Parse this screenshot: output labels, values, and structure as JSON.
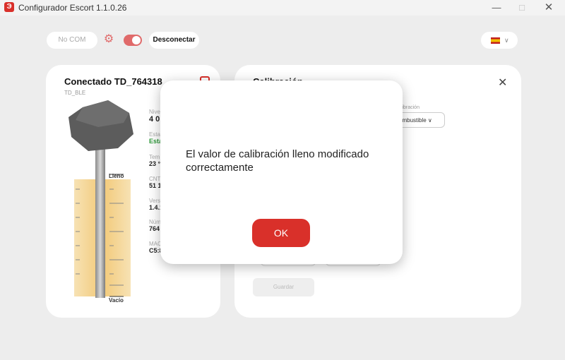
{
  "window": {
    "title": "Configurador Escort 1.1.0.26",
    "icon_letter": "Э"
  },
  "toolbar": {
    "com_label": "No COM",
    "disconnect_label": "Desconectar",
    "language_flag": "es-flag-icon"
  },
  "device": {
    "title": "Conectado  TD_764318",
    "subtitle": "TD_BLE",
    "level_full_label": "Lleno",
    "level_empty_label": "Vacío",
    "info": [
      {
        "label": "Nive",
        "value": "4 0",
        "big": true
      },
      {
        "label": "Esta",
        "value": "Esta",
        "green": true
      },
      {
        "label": "Tem",
        "value": "23 °"
      },
      {
        "label": "CNT",
        "value": "51 1"
      },
      {
        "label": "Vers",
        "value": "1.4.1"
      },
      {
        "label": "Núm",
        "value": "764"
      },
      {
        "label": "MAC",
        "value": "C5:8"
      }
    ]
  },
  "calibration": {
    "title": "Calibración",
    "select_label": "alibración",
    "select_value": "ombustible",
    "save_label": "Guardar"
  },
  "dialog": {
    "message": "El valor de calibración lleno modificado correctamente",
    "ok_label": "OK"
  },
  "colors": {
    "accent": "#d9302a",
    "success": "#2e9b3a",
    "background": "#ededed"
  }
}
